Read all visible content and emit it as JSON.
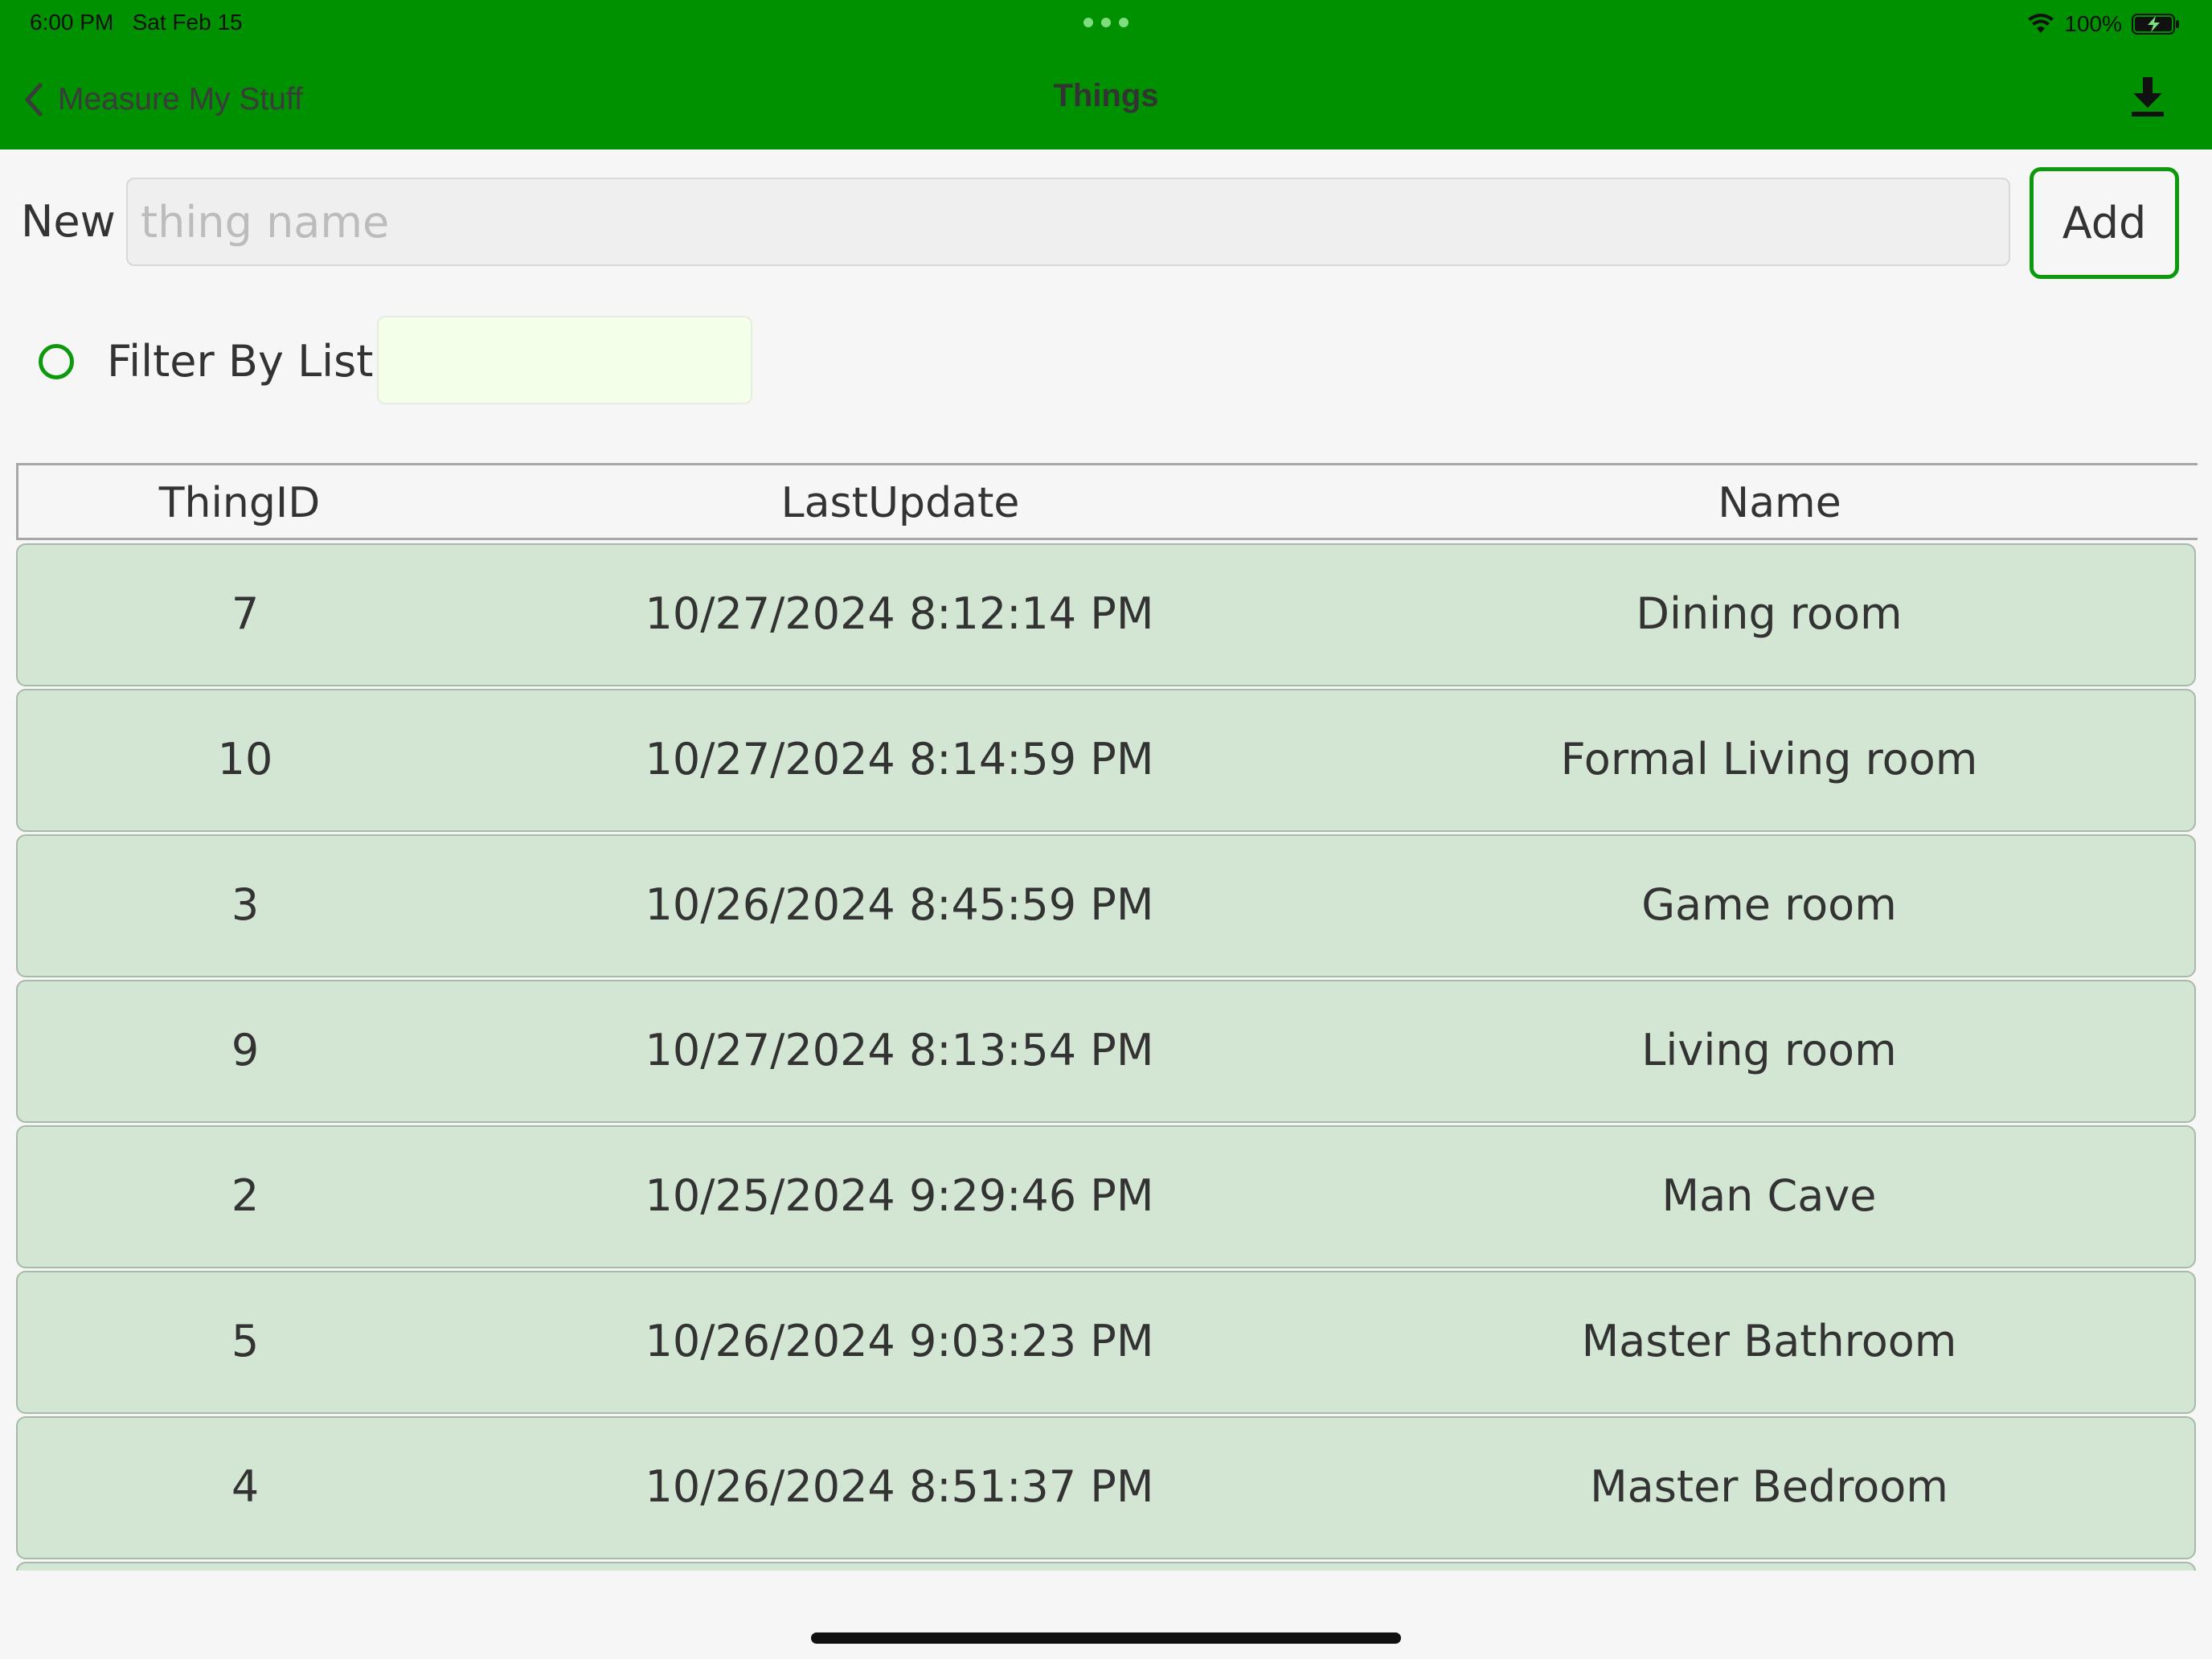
{
  "status_bar": {
    "time": "6:00 PM",
    "date": "Sat Feb 15",
    "battery": "100%"
  },
  "nav": {
    "back_label": "Measure My Stuff",
    "title": "Things"
  },
  "new_thing": {
    "label": "New",
    "placeholder": "thing name",
    "value": "",
    "add_label": "Add"
  },
  "filter": {
    "label": "Filter By List",
    "value": ""
  },
  "table": {
    "columns": [
      "ThingID",
      "LastUpdate",
      "Name"
    ],
    "rows": [
      {
        "id": "7",
        "last_update": "10/27/2024 8:12:14 PM",
        "name": "Dining room"
      },
      {
        "id": "10",
        "last_update": "10/27/2024 8:14:59 PM",
        "name": "Formal Living room"
      },
      {
        "id": "3",
        "last_update": "10/26/2024 8:45:59 PM",
        "name": "Game room"
      },
      {
        "id": "9",
        "last_update": "10/27/2024 8:13:54 PM",
        "name": "Living room"
      },
      {
        "id": "2",
        "last_update": "10/25/2024 9:29:46 PM",
        "name": "Man Cave"
      },
      {
        "id": "5",
        "last_update": "10/26/2024 9:03:23 PM",
        "name": "Master Bathroom"
      },
      {
        "id": "4",
        "last_update": "10/26/2024 8:51:37 PM",
        "name": "Master Bedroom"
      }
    ]
  },
  "colors": {
    "header_green": "#009100",
    "accent_green": "#0c9a0c",
    "row_bg": "#d3e6d3",
    "filter_input_bg": "#f4ffea"
  },
  "icons": {
    "back": "chevron-left-icon",
    "download": "download-icon",
    "wifi": "wifi-icon",
    "battery": "battery-charging-icon",
    "filter_toggle": "radio-circle-icon"
  }
}
